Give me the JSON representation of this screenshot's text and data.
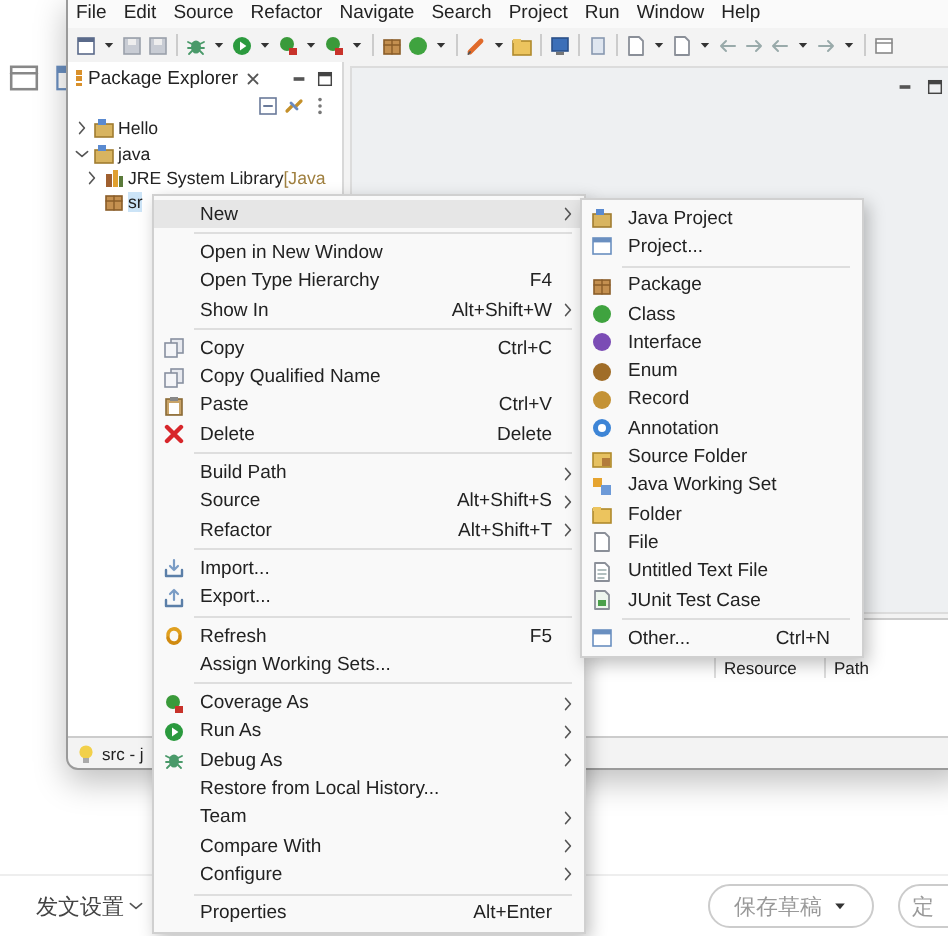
{
  "window": {
    "menu_bar": [
      "File",
      "Edit",
      "Source",
      "Refactor",
      "Navigate",
      "Search",
      "Project",
      "Run",
      "Window",
      "Help"
    ],
    "package_explorer": {
      "title": "Package Explorer",
      "tree": [
        {
          "label": "Hello",
          "expanded": false,
          "selected": false
        },
        {
          "label": "java",
          "expanded": true,
          "selected": false,
          "children": [
            {
              "label": "JRE System Library",
              "suffix": "[Java",
              "expanded": false,
              "selected": false
            },
            {
              "label": "sr",
              "selected": true
            }
          ]
        }
      ]
    },
    "problems_table": {
      "columns": [
        "Resource",
        "Path"
      ]
    },
    "status_bar": "src - j"
  },
  "context_menu": {
    "items": [
      {
        "kind": "item",
        "label": "New",
        "submenu": true,
        "selected": true
      },
      {
        "kind": "separator"
      },
      {
        "kind": "item",
        "label": "Open in New Window",
        "selected": false
      },
      {
        "kind": "item",
        "label": "Open Type Hierarchy",
        "shortcut": "F4",
        "selected": false
      },
      {
        "kind": "item",
        "label": "Show In",
        "shortcut": "Alt+Shift+W",
        "submenu": true,
        "selected": false
      },
      {
        "kind": "separator"
      },
      {
        "kind": "item",
        "label": "Copy",
        "shortcut": "Ctrl+C",
        "selected": false
      },
      {
        "kind": "item",
        "label": "Copy Qualified Name",
        "selected": false
      },
      {
        "kind": "item",
        "label": "Paste",
        "shortcut": "Ctrl+V",
        "selected": false
      },
      {
        "kind": "item",
        "label": "Delete",
        "shortcut": "Delete",
        "selected": false
      },
      {
        "kind": "separator"
      },
      {
        "kind": "item",
        "label": "Build Path",
        "submenu": true,
        "selected": false
      },
      {
        "kind": "item",
        "label": "Source",
        "shortcut": "Alt+Shift+S",
        "submenu": true,
        "selected": false
      },
      {
        "kind": "item",
        "label": "Refactor",
        "shortcut": "Alt+Shift+T",
        "submenu": true,
        "selected": false
      },
      {
        "kind": "separator"
      },
      {
        "kind": "item",
        "label": "Import...",
        "selected": false
      },
      {
        "kind": "item",
        "label": "Export...",
        "selected": false
      },
      {
        "kind": "separator"
      },
      {
        "kind": "item",
        "label": "Refresh",
        "shortcut": "F5",
        "selected": false
      },
      {
        "kind": "item",
        "label": "Assign Working Sets...",
        "selected": false
      },
      {
        "kind": "separator"
      },
      {
        "kind": "item",
        "label": "Coverage As",
        "submenu": true,
        "selected": false
      },
      {
        "kind": "item",
        "label": "Run As",
        "submenu": true,
        "selected": false
      },
      {
        "kind": "item",
        "label": "Debug As",
        "submenu": true,
        "selected": false
      },
      {
        "kind": "item",
        "label": "Restore from Local History...",
        "selected": false
      },
      {
        "kind": "item",
        "label": "Team",
        "submenu": true,
        "selected": false
      },
      {
        "kind": "item",
        "label": "Compare With",
        "submenu": true,
        "selected": false
      },
      {
        "kind": "item",
        "label": "Configure",
        "submenu": true,
        "selected": false
      },
      {
        "kind": "separator"
      },
      {
        "kind": "item",
        "label": "Properties",
        "shortcut": "Alt+Enter",
        "selected": false
      }
    ]
  },
  "new_submenu": {
    "items": [
      {
        "kind": "item",
        "label": "Java Project",
        "selected": false
      },
      {
        "kind": "item",
        "label": "Project...",
        "selected": false
      },
      {
        "kind": "separator"
      },
      {
        "kind": "item",
        "label": "Package",
        "selected": false
      },
      {
        "kind": "item",
        "label": "Class",
        "selected": false
      },
      {
        "kind": "item",
        "label": "Interface",
        "selected": false
      },
      {
        "kind": "item",
        "label": "Enum",
        "selected": false
      },
      {
        "kind": "item",
        "label": "Record",
        "selected": false
      },
      {
        "kind": "item",
        "label": "Annotation",
        "selected": false
      },
      {
        "kind": "item",
        "label": "Source Folder",
        "selected": false
      },
      {
        "kind": "item",
        "label": "Java Working Set",
        "selected": false
      },
      {
        "kind": "item",
        "label": "Folder",
        "selected": false
      },
      {
        "kind": "item",
        "label": "File",
        "selected": false
      },
      {
        "kind": "item",
        "label": "Untitled Text File",
        "selected": false
      },
      {
        "kind": "item",
        "label": "JUnit Test Case",
        "selected": false
      },
      {
        "kind": "separator"
      },
      {
        "kind": "item",
        "label": "Other...",
        "shortcut": "Ctrl+N",
        "selected": false
      }
    ]
  },
  "footer": {
    "settings_label": "发文设置",
    "buttons": [
      "保存草稿",
      "定"
    ]
  }
}
